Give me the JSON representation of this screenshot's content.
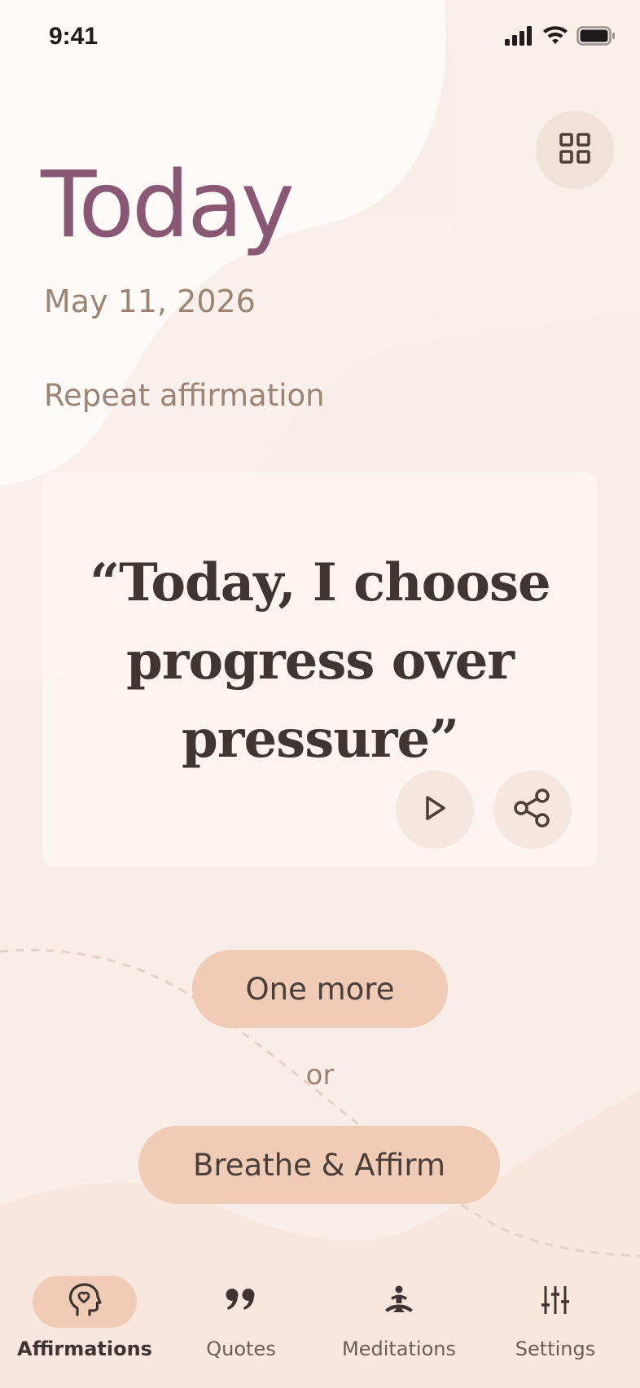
{
  "status_bar": {
    "time": "9:41"
  },
  "icons": {
    "grid": "grid-icon",
    "play": "play-icon",
    "share": "share-icon",
    "affirmations": "head-heart-icon",
    "quotes": "quote-icon",
    "meditations": "meditation-icon",
    "settings": "sliders-icon"
  },
  "header": {
    "title": "Today",
    "date": "May 11, 2026"
  },
  "section": {
    "label": "Repeat affirmation"
  },
  "affirmation": {
    "text": "“Today, I choose progress over pressure”"
  },
  "actions": {
    "one_more": "One more",
    "or": "or",
    "breathe": "Breathe & Affirm"
  },
  "nav": {
    "items": [
      {
        "label": "Affirmations",
        "active": true
      },
      {
        "label": "Quotes",
        "active": false
      },
      {
        "label": "Meditations",
        "active": false
      },
      {
        "label": "Settings",
        "active": false
      }
    ]
  },
  "colors": {
    "background": "#f8ede7",
    "title": "#8a5874",
    "muted_text": "#9b8476",
    "accent_pill": "#f0cbb6",
    "dark_text": "#3f3633"
  }
}
